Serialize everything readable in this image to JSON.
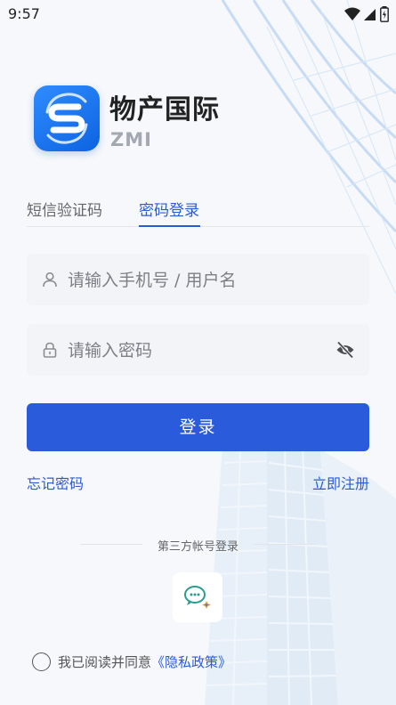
{
  "status_bar": {
    "time": "9:57"
  },
  "brand": {
    "name": "物产国际",
    "sub": "ZMI"
  },
  "tabs": [
    {
      "label": "短信验证码",
      "active": false
    },
    {
      "label": "密码登录",
      "active": true
    }
  ],
  "form": {
    "phone_placeholder": "请输入手机号 / 用户名",
    "password_placeholder": "请输入密码"
  },
  "login_button": "登录",
  "links": {
    "forgot": "忘记密码",
    "register": "立即注册"
  },
  "third_party": {
    "label": "第三方帐号登录",
    "provider_icon": "wechat-icon"
  },
  "agreement": {
    "text": "我已阅读并同意",
    "policy": "《隐私政策》"
  },
  "colors": {
    "accent": "#2a5bdb",
    "background": "#f6f8fb"
  }
}
